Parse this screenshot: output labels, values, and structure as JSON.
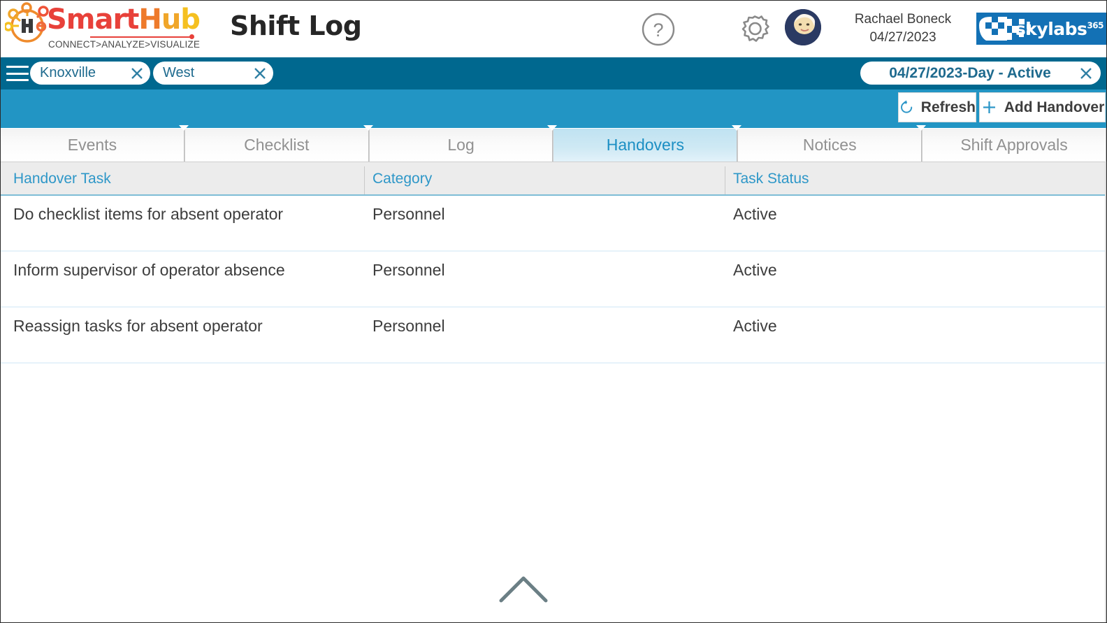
{
  "header": {
    "logo": {
      "name_parts": [
        "Smart",
        "H",
        "u",
        "b"
      ],
      "tagline": "CONNECT>ANALYZE>VISUALIZE",
      "icon": "smarthub-logo-icon"
    },
    "page_title": "Shift Log",
    "help_icon": "help-circle-icon",
    "settings_icon": "gear-icon",
    "avatar_icon": "user-avatar",
    "user_name": "Rachael Boneck",
    "user_date": "04/27/2023",
    "brand": {
      "text": "skylabs",
      "superscript": "365",
      "icon": "skylabs365-logo-icon"
    }
  },
  "filterbar": {
    "menu_icon": "hamburger-menu-icon",
    "chips": [
      {
        "label": "Knoxville",
        "clear_icon": "close-icon"
      },
      {
        "label": "West",
        "clear_icon": "close-icon"
      }
    ],
    "shift_selector": {
      "label": "04/27/2023-Day - Active",
      "clear_icon": "close-icon"
    }
  },
  "actionbar": {
    "refresh": {
      "label": "Refresh",
      "icon": "refresh-icon"
    },
    "add_handover": {
      "label": "Add Handover",
      "icon": "plus-icon"
    }
  },
  "tabs": [
    {
      "label": "Events",
      "active": false
    },
    {
      "label": "Checklist",
      "active": false
    },
    {
      "label": "Log",
      "active": false
    },
    {
      "label": "Handovers",
      "active": true
    },
    {
      "label": "Notices",
      "active": false
    },
    {
      "label": "Shift Approvals",
      "active": false
    }
  ],
  "table": {
    "columns": [
      "Handover Task",
      "Category",
      "Task Status"
    ],
    "rows": [
      {
        "task": "Do checklist items for absent operator",
        "category": "Personnel",
        "status": "Active"
      },
      {
        "task": "Inform supervisor of operator absence",
        "category": "Personnel",
        "status": "Active"
      },
      {
        "task": "Reassign tasks for absent operator",
        "category": "Personnel",
        "status": "Active"
      }
    ]
  },
  "footer": {
    "collapse_icon": "chevron-up-icon"
  },
  "colors": {
    "dark_teal": "#00688f",
    "mid_teal": "#2295c4",
    "header_link": "#2e97c8",
    "active_tab_text": "#1c8fc4",
    "brand_blue": "#1371b5",
    "row_divider": "#e6f2fa"
  }
}
